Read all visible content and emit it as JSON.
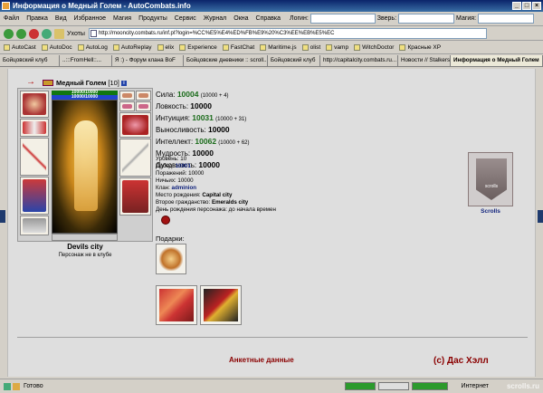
{
  "window": {
    "title": "Информация о Медный Голем - AutoCombats.info"
  },
  "menu": {
    "items": [
      "Файл",
      "Правка",
      "Вид",
      "Избранное",
      "Магия",
      "Продукты",
      "Сервис",
      "Журнал",
      "Окна",
      "Справка"
    ],
    "login_label": "Логин:",
    "beast_label": "Зверь:",
    "magic_label": "Магия:"
  },
  "toolbar": {
    "tools_label": "Уxоты",
    "address": "http://mooncity.combats.ru/inf.pl?login=%CC%E5%E4%ED%FB%E9%20%C3%EE%EB%E5%EC"
  },
  "bookmarks": [
    "AutoCast",
    "AutoDoc",
    "AutoLog",
    "AutoReplay",
    "elix",
    "Experience",
    "FastChat",
    "Maritime.js",
    "olist",
    "vamp",
    "WitchDoctor",
    "Красные XP"
  ],
  "tabs": [
    {
      "label": "Бойцовский клуб",
      "active": false
    },
    {
      "label": "..:::FromHell::...",
      "active": false
    },
    {
      "label": "Я :) - Форум клана BoF",
      "active": false
    },
    {
      "label": "Бойцовские дневники :: scroll...",
      "active": false
    },
    {
      "label": "Бойцовский клуб",
      "active": false
    },
    {
      "label": "http://capitalcity.combats.ru...",
      "active": false
    },
    {
      "label": "Новости // Stalkers",
      "active": false
    },
    {
      "label": "Информация о Медный Голем",
      "active": true
    }
  ],
  "character": {
    "name": "Медный Голем",
    "level": "[10]",
    "info_icon_letter": "i",
    "hp": "10000/10000",
    "mp": "10000/10000",
    "city": "Devils city",
    "clan_status": "Персонаж не в клубе"
  },
  "stats": [
    {
      "label": "Сила:",
      "value": "10004",
      "extra": "(10000 + 4)",
      "color": "g"
    },
    {
      "label": "Ловкость:",
      "value": "10000",
      "extra": "",
      "color": "b"
    },
    {
      "label": "Интуиция:",
      "value": "10031",
      "extra": "(10000 + 31)",
      "color": "g"
    },
    {
      "label": "Выносливость:",
      "value": "10000",
      "extra": "",
      "color": "b"
    },
    {
      "label": "Интеллект:",
      "value": "10062",
      "extra": "(10000 + 62)",
      "color": "g"
    },
    {
      "label": "Мудрость:",
      "value": "10000",
      "extra": "",
      "color": "b"
    },
    {
      "label": "Духовность:",
      "value": "10000",
      "extra": "",
      "color": "b"
    }
  ],
  "details": [
    {
      "label": "Уровень:",
      "value": "10",
      "style": ""
    },
    {
      "label": "Побед:",
      "value": "10001",
      "style": "blue"
    },
    {
      "label": "Поражений:",
      "value": "10000",
      "style": ""
    },
    {
      "label": "Ничьих:",
      "value": "10000",
      "style": ""
    },
    {
      "label": "Клан:",
      "value": "adminion",
      "style": "blue"
    },
    {
      "label": "Место рождения:",
      "value": "Capital city",
      "style": "bold"
    },
    {
      "label": "Второе гражданство:",
      "value": "Emeralds city",
      "style": "bold"
    },
    {
      "label": "День рождения персонажа:",
      "value": "до начала времен",
      "style": ""
    }
  ],
  "gifts_label": "Подарки:",
  "scrolls_label": "Scrolls",
  "scrolls_emblem_text": "scrolls",
  "footer": {
    "profile": "Анкетные данные",
    "copyright": "(c) Дас Хэлл"
  },
  "status": {
    "text": "Готово",
    "zone": "Интернет"
  },
  "watermark": "scrolls.ru",
  "colors": {
    "stat_green": "#1a6b1a",
    "link_blue": "#0b1e7a",
    "footer_red": "#8a0000"
  }
}
